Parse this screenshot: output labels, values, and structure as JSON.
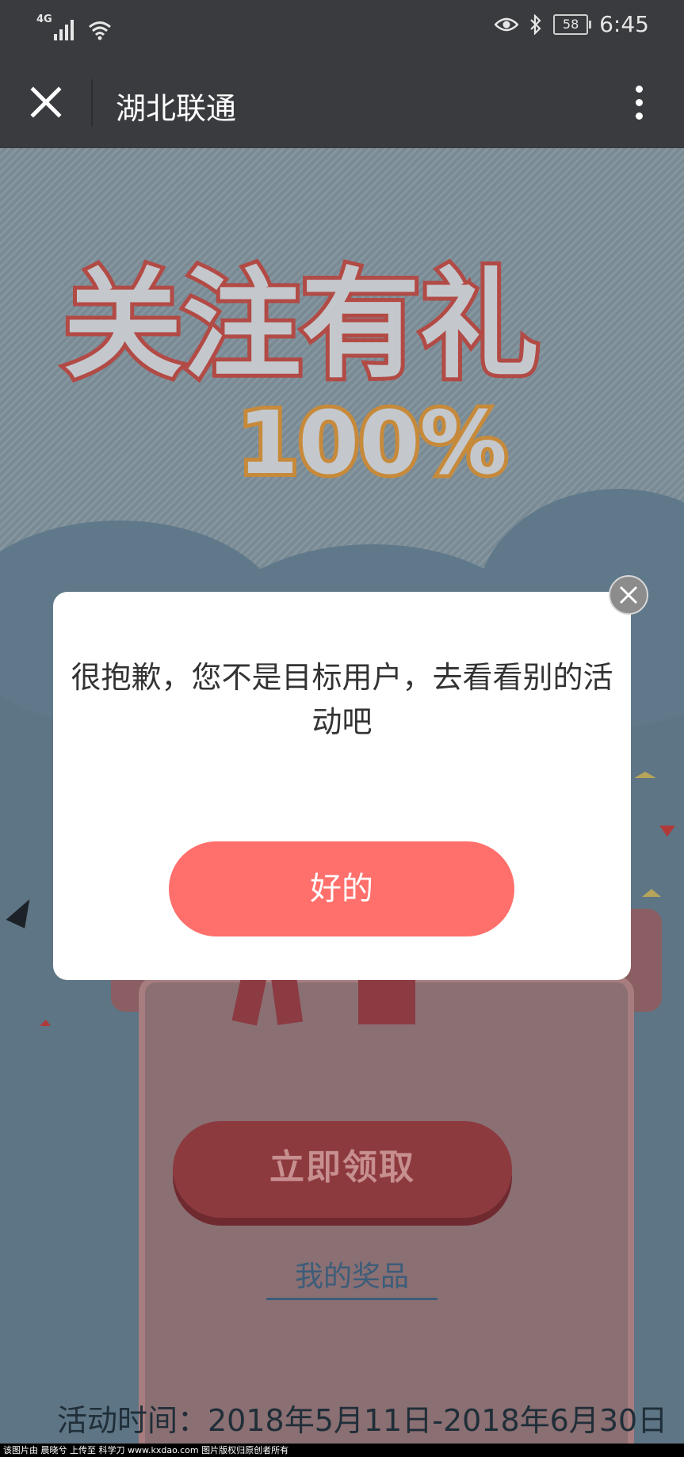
{
  "status_bar": {
    "network": "4G",
    "battery": "58",
    "time": "6:45"
  },
  "title_bar": {
    "title": "湖北联通"
  },
  "banner": {
    "line1": "关注有礼",
    "line2": "100%"
  },
  "modal": {
    "message": "很抱歉，您不是目标用户，去看看别的活动吧",
    "ok_label": "好的"
  },
  "page": {
    "claim_label": "立即领取",
    "prize_link": "我的奖品",
    "period": "活动时间：2018年5月11日-2018年6月30日"
  },
  "watermark": "该图片由 晨晓兮 上传至 科学刀 www.kxdao.com 图片版权归原创者所有"
}
